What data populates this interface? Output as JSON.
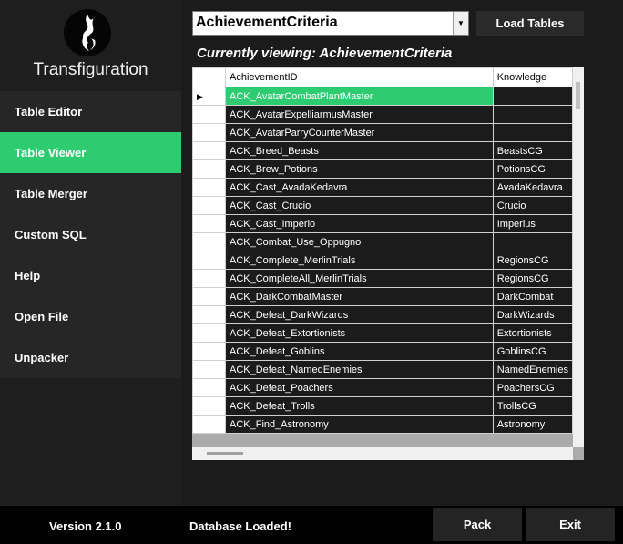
{
  "app": {
    "title": "Transfiguration",
    "logo_icon": "flame-icon"
  },
  "sidebar": {
    "items": [
      {
        "label": "Table Editor",
        "active": false
      },
      {
        "label": "Table Viewer",
        "active": true
      },
      {
        "label": "Table Merger",
        "active": false
      },
      {
        "label": "Custom SQL",
        "active": false
      },
      {
        "label": "Help",
        "active": false
      },
      {
        "label": "Open File",
        "active": false
      },
      {
        "label": "Unpacker",
        "active": false
      }
    ]
  },
  "toolbar": {
    "table_select": "AchievementCriteria",
    "load_label": "Load Tables"
  },
  "viewing": "Currently viewing: AchievementCriteria",
  "grid": {
    "columns": [
      "AchievementID",
      "Knowledge"
    ],
    "rows": [
      [
        "ACK_AvatarCombatPlantMaster",
        ""
      ],
      [
        "ACK_AvatarExpelliarmusMaster",
        ""
      ],
      [
        "ACK_AvatarParryCounterMaster",
        ""
      ],
      [
        "ACK_Breed_Beasts",
        "BeastsCG"
      ],
      [
        "ACK_Brew_Potions",
        "PotionsCG"
      ],
      [
        "ACK_Cast_AvadaKedavra",
        "AvadaKedavra"
      ],
      [
        "ACK_Cast_Crucio",
        "Crucio"
      ],
      [
        "ACK_Cast_Imperio",
        "Imperius"
      ],
      [
        "ACK_Combat_Use_Oppugno",
        ""
      ],
      [
        "ACK_Complete_MerlinTrials",
        "RegionsCG"
      ],
      [
        "ACK_CompleteAll_MerlinTrials",
        "RegionsCG"
      ],
      [
        "ACK_DarkCombatMaster",
        "DarkCombat"
      ],
      [
        "ACK_Defeat_DarkWizards",
        "DarkWizards"
      ],
      [
        "ACK_Defeat_Extortionists",
        "Extortionists"
      ],
      [
        "ACK_Defeat_Goblins",
        "GoblinsCG"
      ],
      [
        "ACK_Defeat_NamedEnemies",
        "NamedEnemies"
      ],
      [
        "ACK_Defeat_Poachers",
        "PoachersCG"
      ],
      [
        "ACK_Defeat_Trolls",
        "TrollsCG"
      ],
      [
        "ACK_Find_Astronomy",
        "Astronomy"
      ]
    ],
    "selected_row": 0
  },
  "footer": {
    "version": "Version 2.1.0",
    "status": "Database Loaded!",
    "pack_label": "Pack",
    "exit_label": "Exit"
  },
  "colors": {
    "accent": "#2ecc71",
    "background": "#1b1b1b"
  }
}
